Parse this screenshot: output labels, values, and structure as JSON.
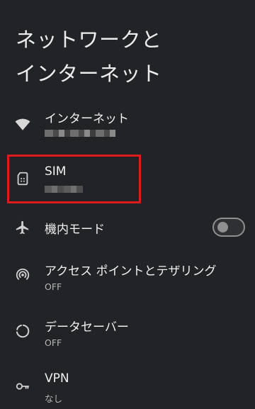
{
  "page": {
    "title_line1": "ネットワークと",
    "title_line2": "インターネット"
  },
  "items": [
    {
      "title": "インターネット",
      "subtitle": "",
      "icon": "wifi-icon"
    },
    {
      "title": "SIM",
      "subtitle": "",
      "icon": "sim-card-icon"
    },
    {
      "title": "機内モード",
      "subtitle": "",
      "icon": "airplane-icon",
      "toggle_on": false
    },
    {
      "title": "アクセス ポイントとテザリング",
      "subtitle": "OFF",
      "icon": "hotspot-icon"
    },
    {
      "title": "データセーバー",
      "subtitle": "OFF",
      "icon": "data-saver-icon"
    },
    {
      "title": "VPN",
      "subtitle": "なし",
      "icon": "vpn-key-icon"
    }
  ],
  "colors": {
    "background": "#222326",
    "highlight_border": "#e0191b"
  }
}
